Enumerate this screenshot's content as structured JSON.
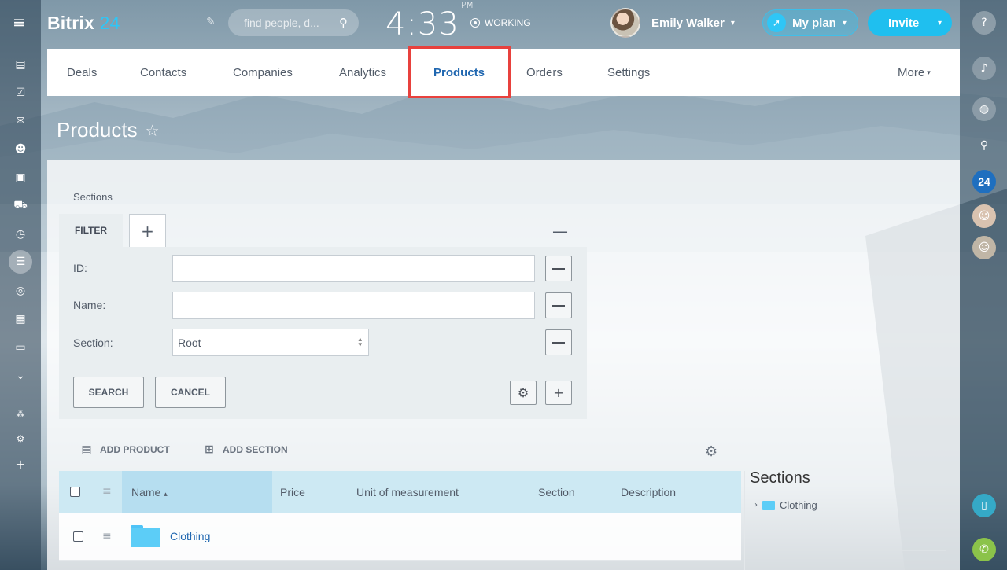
{
  "header": {
    "logo_text": "Bitrix",
    "logo_num": "24",
    "search_placeholder": "find people, d...",
    "clock": "4:33",
    "clock_suffix": "PM",
    "status": "WORKING",
    "user_name": "Emily Walker",
    "myplan_label": "My plan",
    "invite_label": "Invite"
  },
  "nav": {
    "tabs": [
      {
        "label": "Deals"
      },
      {
        "label": "Contacts"
      },
      {
        "label": "Companies"
      },
      {
        "label": "Analytics"
      },
      {
        "label": "Products"
      },
      {
        "label": "Orders"
      },
      {
        "label": "Settings"
      }
    ],
    "more_label": "More"
  },
  "page": {
    "title": "Products"
  },
  "filter": {
    "sections_label": "Sections",
    "tab_label": "FILTER",
    "fields": [
      {
        "label": "ID:",
        "value": ""
      },
      {
        "label": "Name:",
        "value": ""
      },
      {
        "label": "Section:",
        "value": "Root"
      }
    ],
    "search_label": "SEARCH",
    "cancel_label": "CANCEL"
  },
  "actions": {
    "add_product": "ADD PRODUCT",
    "add_section": "ADD SECTION"
  },
  "grid": {
    "columns": [
      "Name",
      "Price",
      "Unit of measurement",
      "Section",
      "Description"
    ],
    "rows": [
      {
        "name": "Clothing"
      }
    ]
  },
  "sections_panel": {
    "title": "Sections",
    "items": [
      {
        "label": "Clothing"
      }
    ]
  },
  "right_bar": {
    "badge": "24"
  },
  "colors": {
    "accent": "#2fc6f6",
    "active_tab": "#2067b0",
    "highlight": "#e8413d"
  }
}
